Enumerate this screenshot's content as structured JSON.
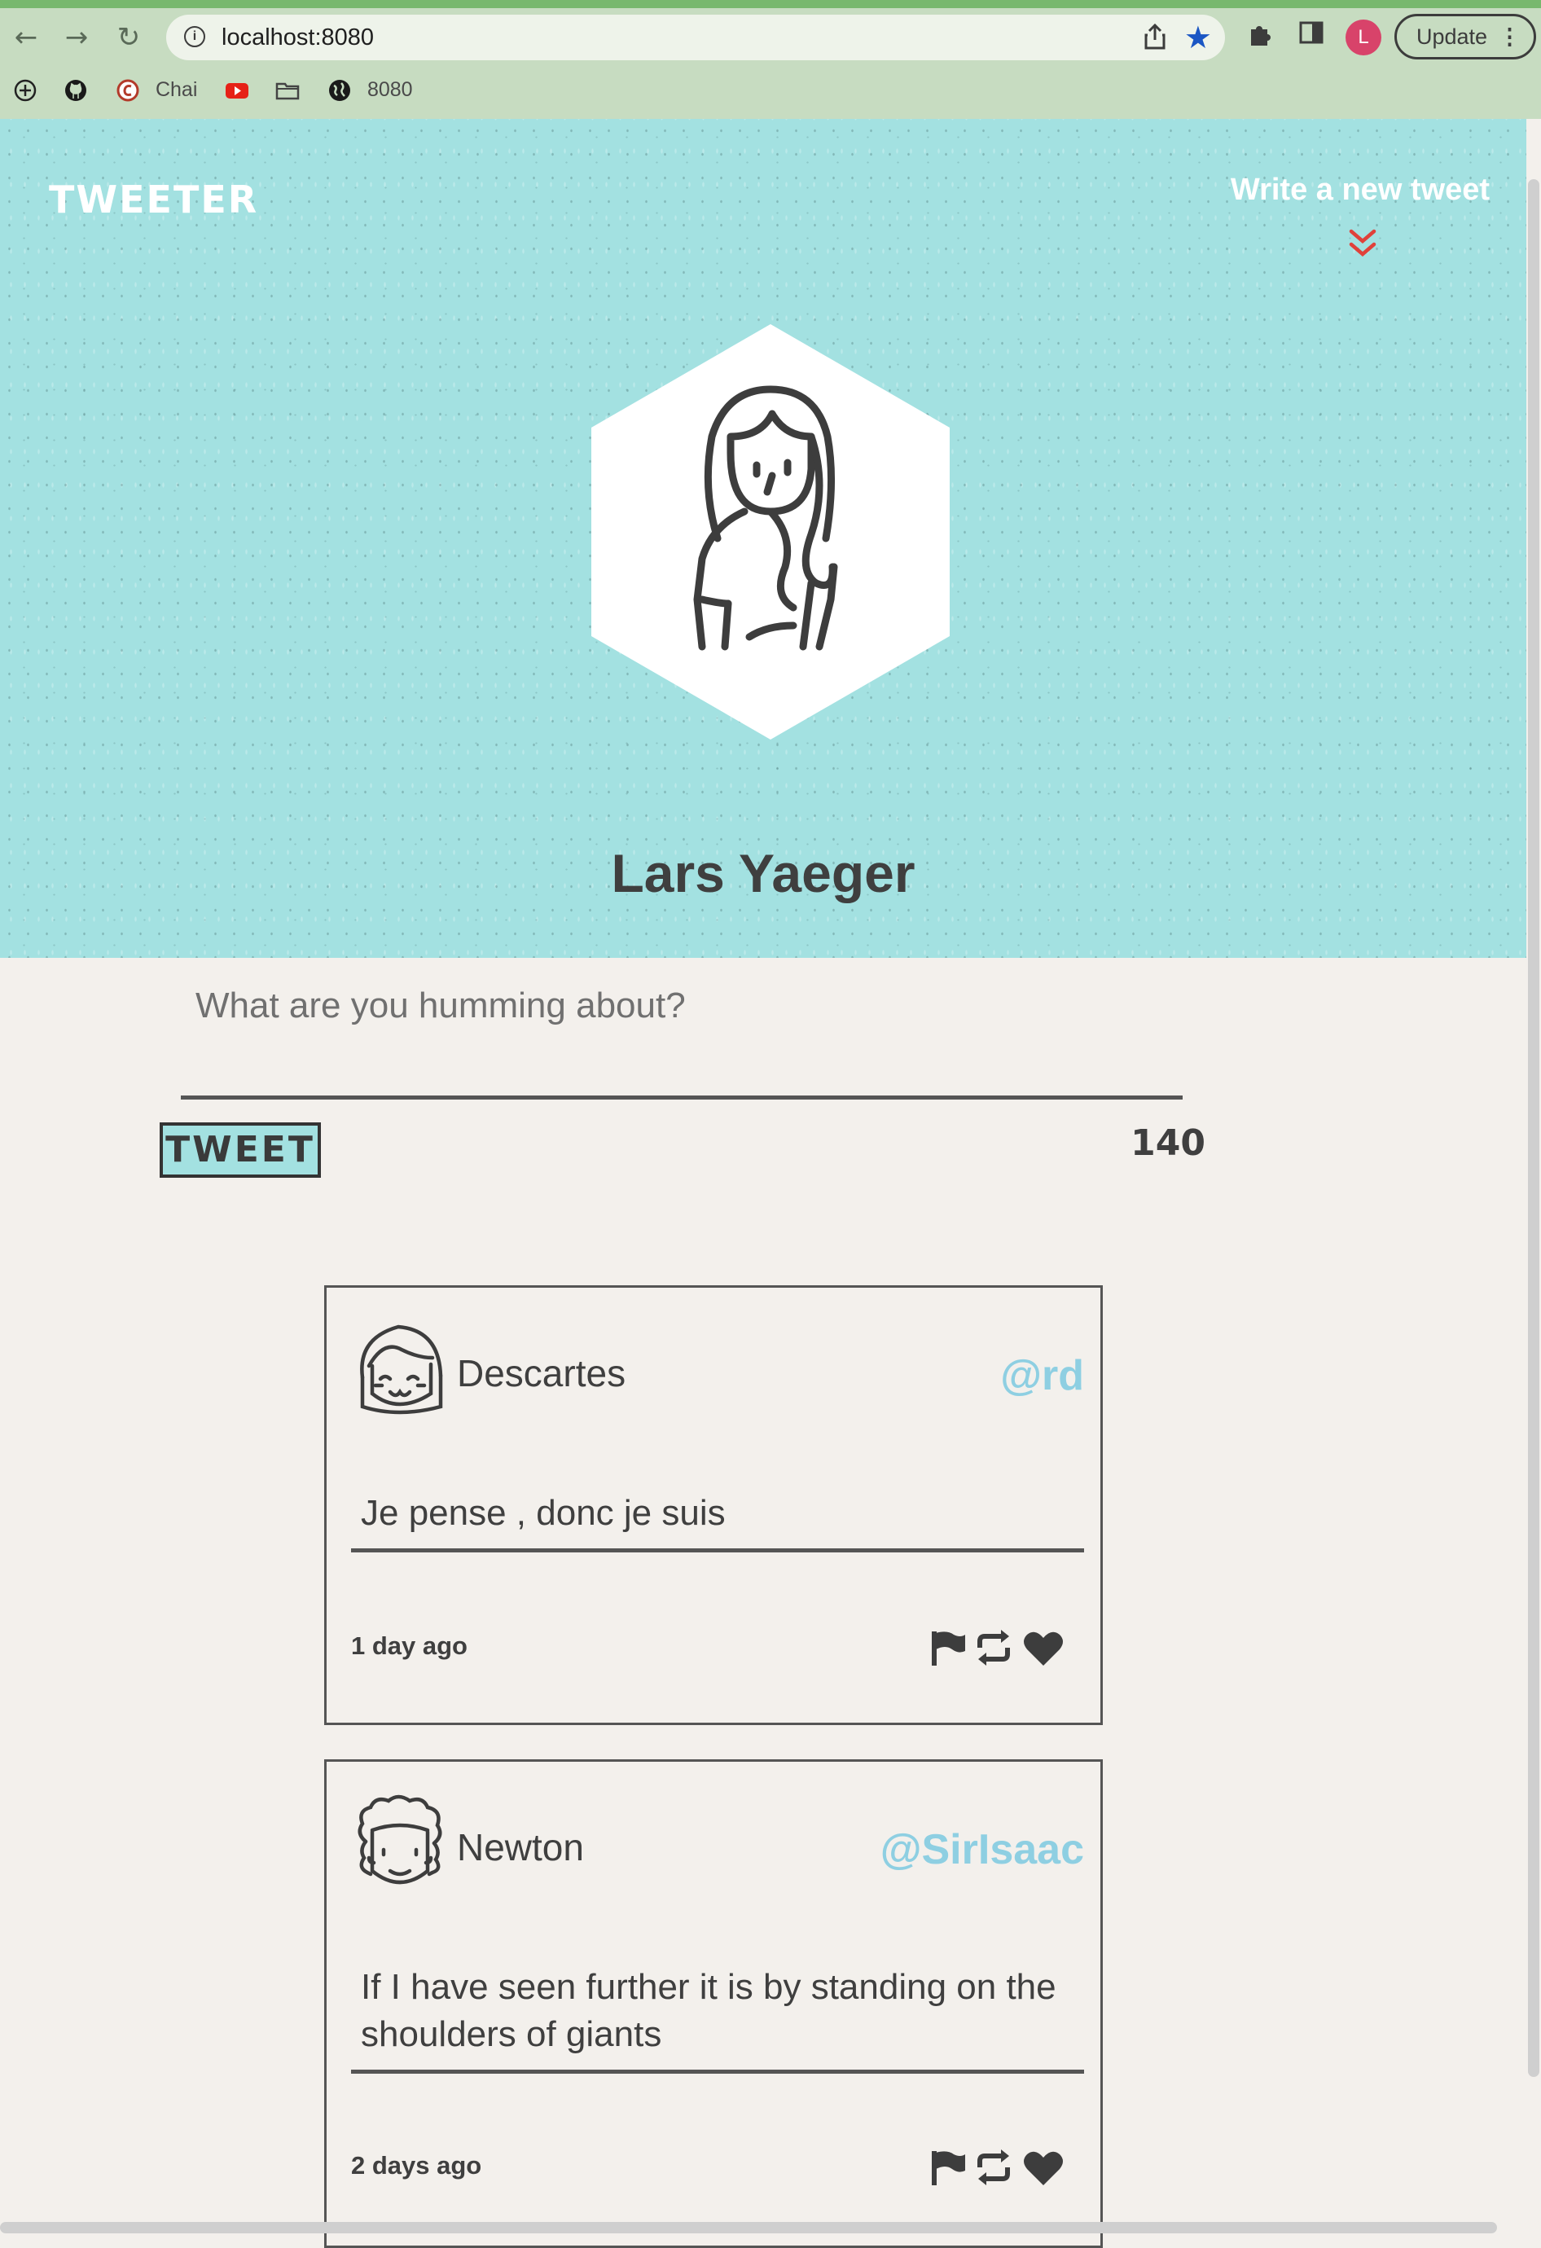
{
  "browser": {
    "url": "localhost:8080",
    "profile_initial": "L",
    "update_label": "Update",
    "bookmarks": [
      {
        "label": ""
      },
      {
        "label": ""
      },
      {
        "label": "Chai"
      },
      {
        "label": ""
      },
      {
        "label": ""
      },
      {
        "label": "8080"
      }
    ]
  },
  "header": {
    "brand": "TWEETER",
    "write_new_tweet": "Write a new tweet"
  },
  "profile": {
    "name": "Lars Yaeger"
  },
  "composer": {
    "placeholder": "What are you humming about?",
    "button_label": "TWEET",
    "counter": "140"
  },
  "tweets": [
    {
      "name": "Descartes",
      "handle": "@rd",
      "content": "Je pense , donc je suis",
      "time": "1 day ago"
    },
    {
      "name": "Newton",
      "handle": "@SirIsaac",
      "content": "If I have seen further it is by standing on the shoulders of giants",
      "time": "2 days ago"
    }
  ],
  "colors": {
    "hero_bg": "#a3e1e1",
    "page_bg": "#f3f0ec",
    "handle": "#8ecfe2",
    "chevron": "#e0413a"
  }
}
